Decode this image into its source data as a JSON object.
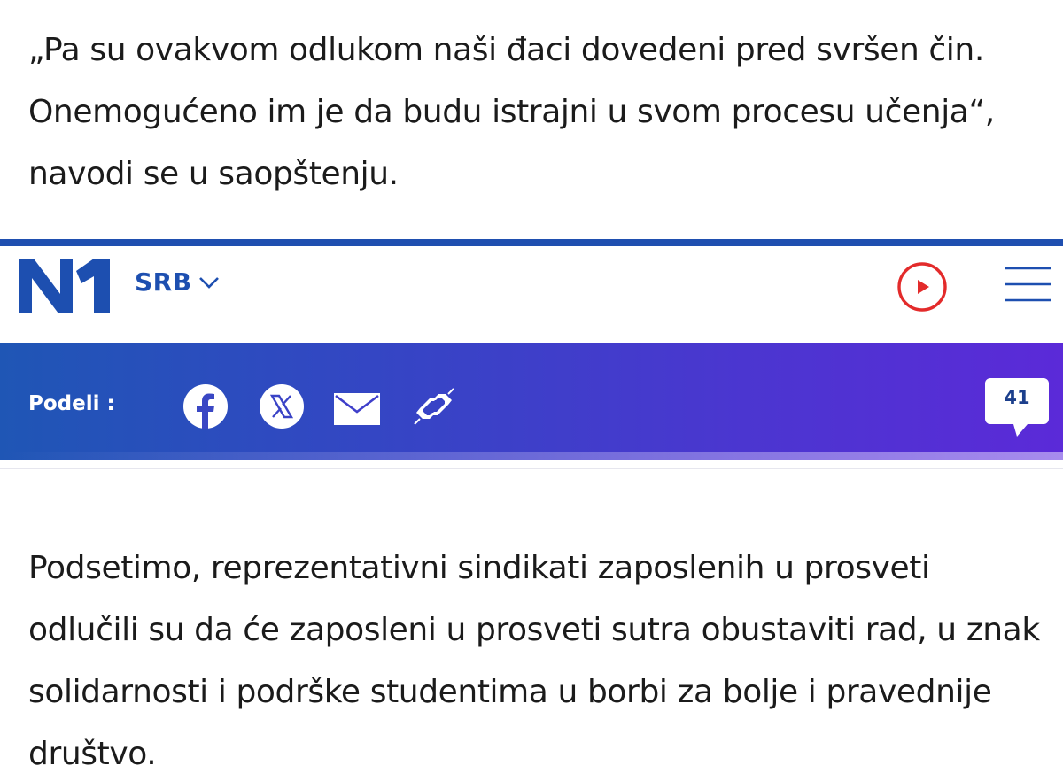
{
  "article": {
    "paragraph_top": "„Pa su ovakvom odlukom naši đaci dovedeni pred svršen čin. Onemogućeno im je da budu istrajni u svom procesu učenja“, navodi se u saopštenju.",
    "paragraph_bottom": "Podsetimo, reprezentativni sindikati zaposlenih u prosveti odlučili su da će zaposleni u prosveti sutra obustaviti rad, u znak solidarnosti i podrške studentima u borbi za bolje i pravednije društvo."
  },
  "header": {
    "logo_text": "N1",
    "region_label": "SRB",
    "region_icon": "chevron-down-icon",
    "play_icon": "play-circle-icon",
    "menu_icon": "hamburger-menu-icon"
  },
  "share_bar": {
    "label": "Podeli :",
    "icons": [
      "facebook-icon",
      "x-icon",
      "mail-icon",
      "copy-link-icon"
    ],
    "comment_count": "41"
  },
  "colors": {
    "brand_blue": "#1d4fb0",
    "play_red": "#e32b2b",
    "gradient_start": "#1f56b5",
    "gradient_end": "#5b2ad8"
  }
}
